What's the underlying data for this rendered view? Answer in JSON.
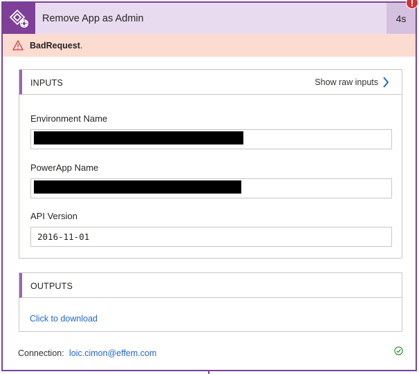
{
  "header": {
    "title": "Remove App as Admin",
    "duration": "4s",
    "icon": "powerapps-admin-icon",
    "error_badge": "!",
    "accent_color": "#7d3f98"
  },
  "error": {
    "message": "BadRequest",
    "suffix": ".",
    "icon": "warning-icon",
    "color": "#d13438"
  },
  "inputs": {
    "title": "INPUTS",
    "show_raw_label": "Show raw inputs",
    "fields": [
      {
        "label": "Environment Name",
        "value": "",
        "redacted": true
      },
      {
        "label": "PowerApp Name",
        "value": "",
        "redacted": true
      },
      {
        "label": "API Version",
        "value": "2016-11-01",
        "redacted": false
      }
    ]
  },
  "outputs": {
    "title": "OUTPUTS",
    "download_label": "Click to download"
  },
  "footer": {
    "connection_label": "Connection:",
    "connection_value": "loic.cimon@effem.com",
    "status_icon": "check-circle-icon"
  }
}
